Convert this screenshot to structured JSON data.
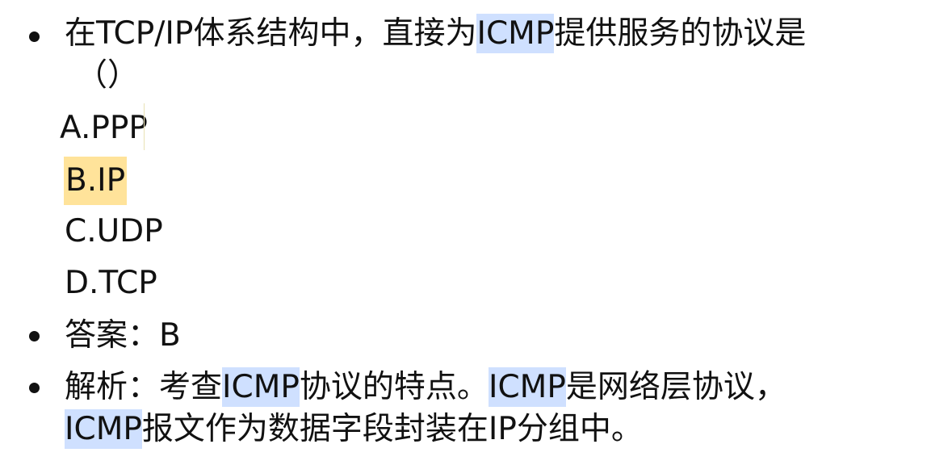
{
  "question": {
    "part1": "在TCP/IP体系结构中，直接为",
    "hl": "ICMP",
    "part2": "提供服务的协议是",
    "paren": "（）"
  },
  "options": [
    {
      "label": "A.PPP"
    },
    {
      "label": "B.IP"
    },
    {
      "label": "C.UDP"
    },
    {
      "label": "D.TCP"
    }
  ],
  "answer": {
    "text": "答案：B"
  },
  "analysis": {
    "p1": "解析：考查",
    "hl1": "ICMP",
    "p2": "协议的特点。",
    "hl2": "ICMP",
    "p3": "是网络层协议，",
    "hl3": "ICMP",
    "p4": "报文作为数据字段封装在IP分组中。"
  },
  "colors": {
    "highlight_blue": "#cfe0ff",
    "highlight_yellow": "#ffe39a"
  }
}
